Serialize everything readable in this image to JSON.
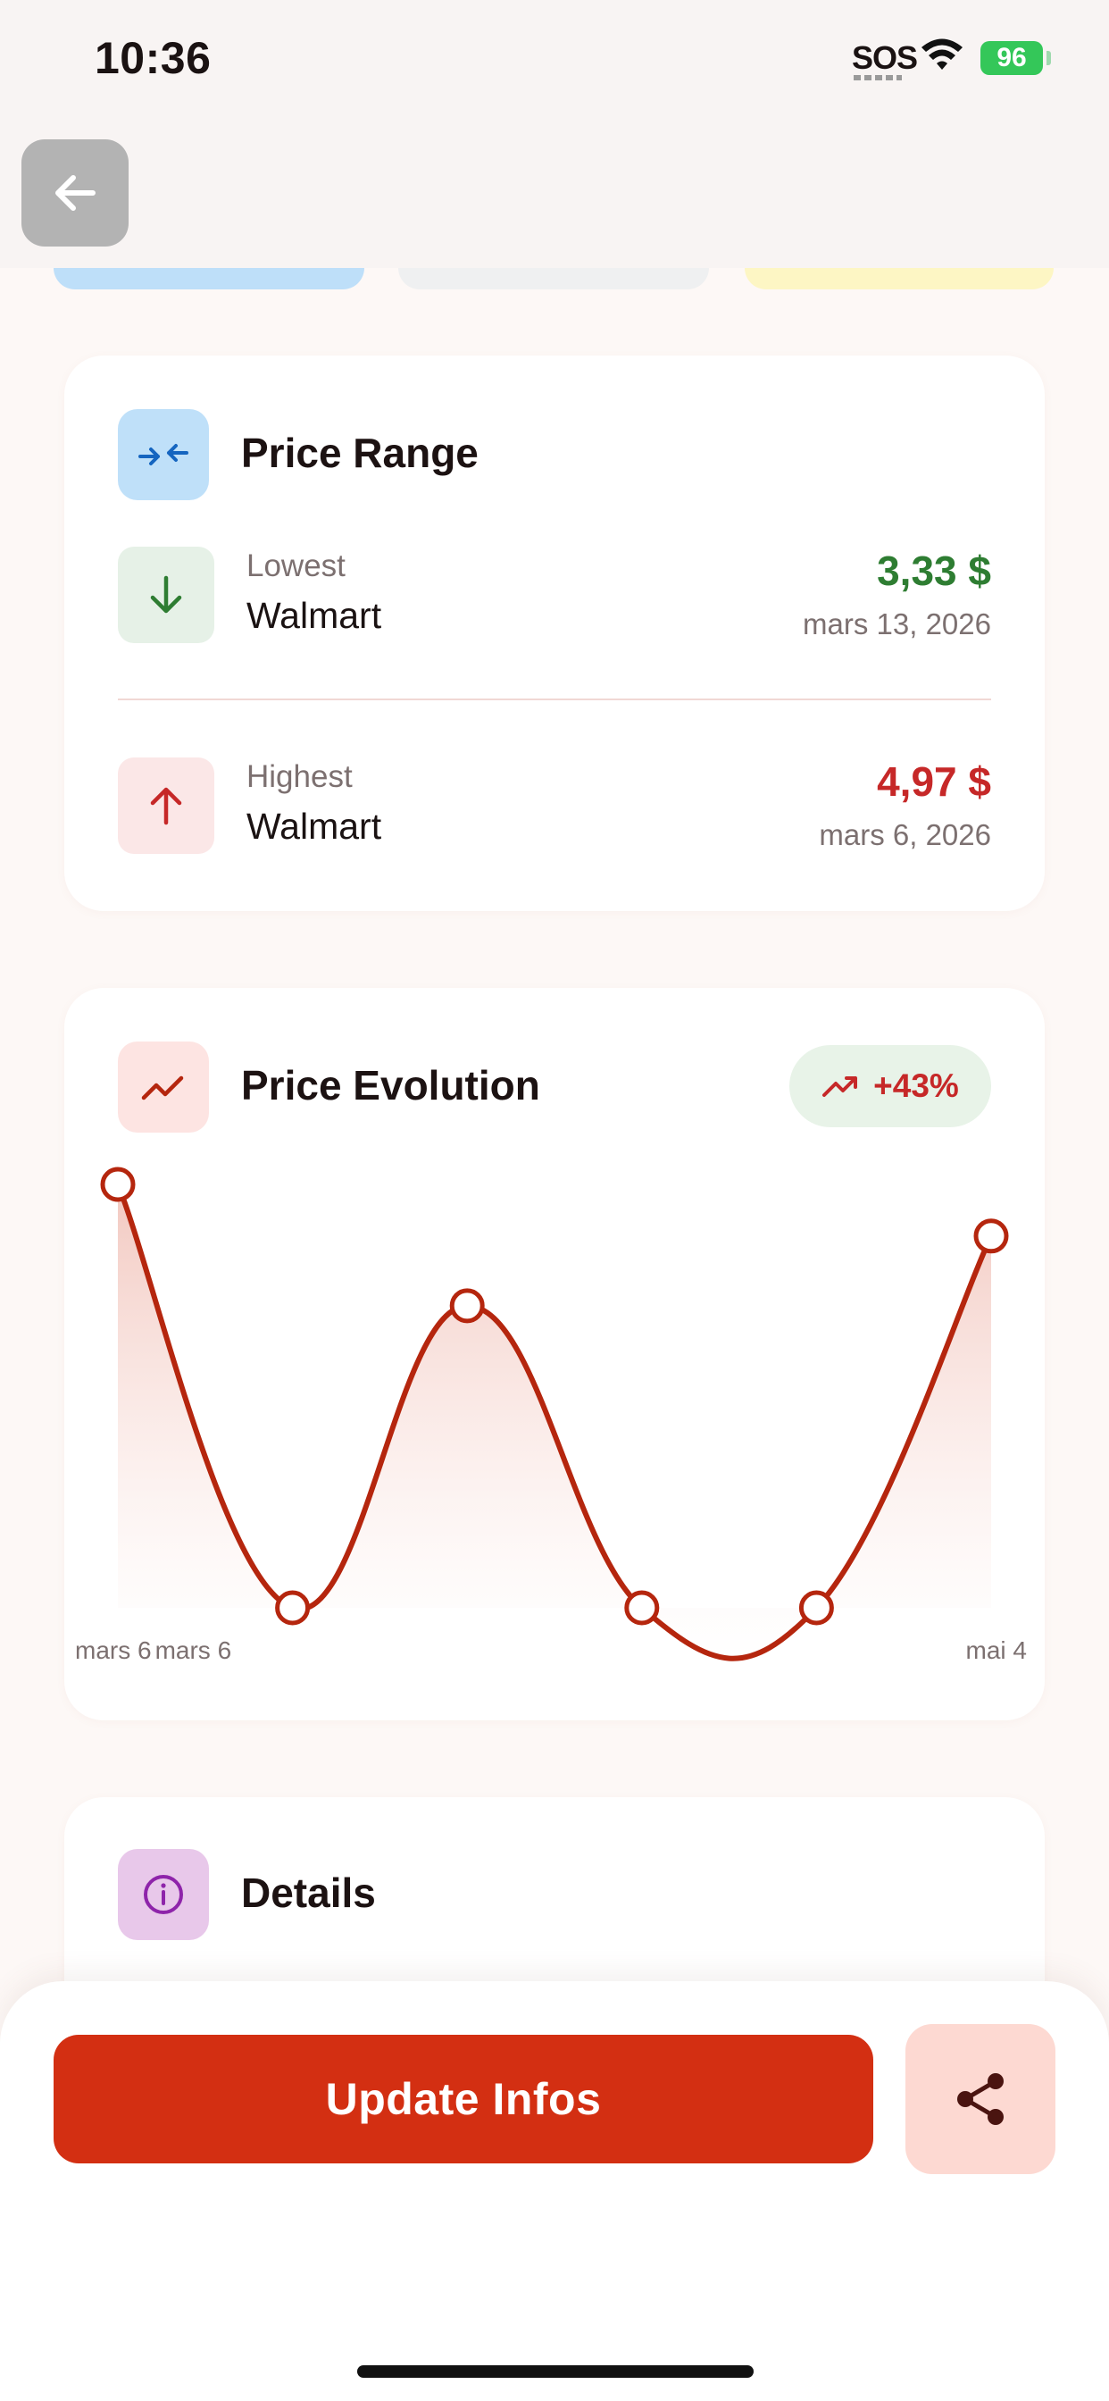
{
  "status_bar": {
    "time": "10:36",
    "carrier": "SOS",
    "battery": "96"
  },
  "chips_peek": [
    {
      "color": "#bedff9"
    },
    {
      "color": "#eff0f1"
    },
    {
      "color": "#fdf6c4"
    }
  ],
  "price_range": {
    "title": "Price Range",
    "icon": "compress-arrows-icon",
    "lowest": {
      "label": "Lowest",
      "store": "Walmart",
      "price": "3,33 $",
      "date": "mars 13, 2026",
      "icon": "arrow-down-icon"
    },
    "highest": {
      "label": "Highest",
      "store": "Walmart",
      "price": "4,97 $",
      "date": "mars 6, 2026",
      "icon": "arrow-up-icon"
    }
  },
  "price_evolution": {
    "title": "Price Evolution",
    "icon": "trending-chart-icon",
    "change_badge": "+43%",
    "change_icon": "trending-up-icon"
  },
  "chart_data": {
    "type": "line",
    "title": "",
    "x": [
      "mars 6",
      "mars 6",
      "",
      "",
      "",
      "mai 4"
    ],
    "tick_labels": [
      "mars 6",
      "mars 6",
      "mai 4"
    ],
    "series": [
      {
        "values": [
          4.97,
          3.33,
          4.5,
          3.33,
          3.33,
          4.77
        ]
      }
    ],
    "ylim": [
      3.33,
      4.97
    ],
    "grid": false,
    "legend": "none",
    "area_fill": true,
    "line_color": "#b5260e"
  },
  "details": {
    "title": "Details",
    "icon": "info-icon"
  },
  "actions": {
    "update_label": "Update Infos",
    "share_icon": "share-icon"
  },
  "colors": {
    "accent": "#d32f12",
    "positive": "#2e7d32",
    "negative": "#c62828",
    "background": "#fdf8f6"
  }
}
